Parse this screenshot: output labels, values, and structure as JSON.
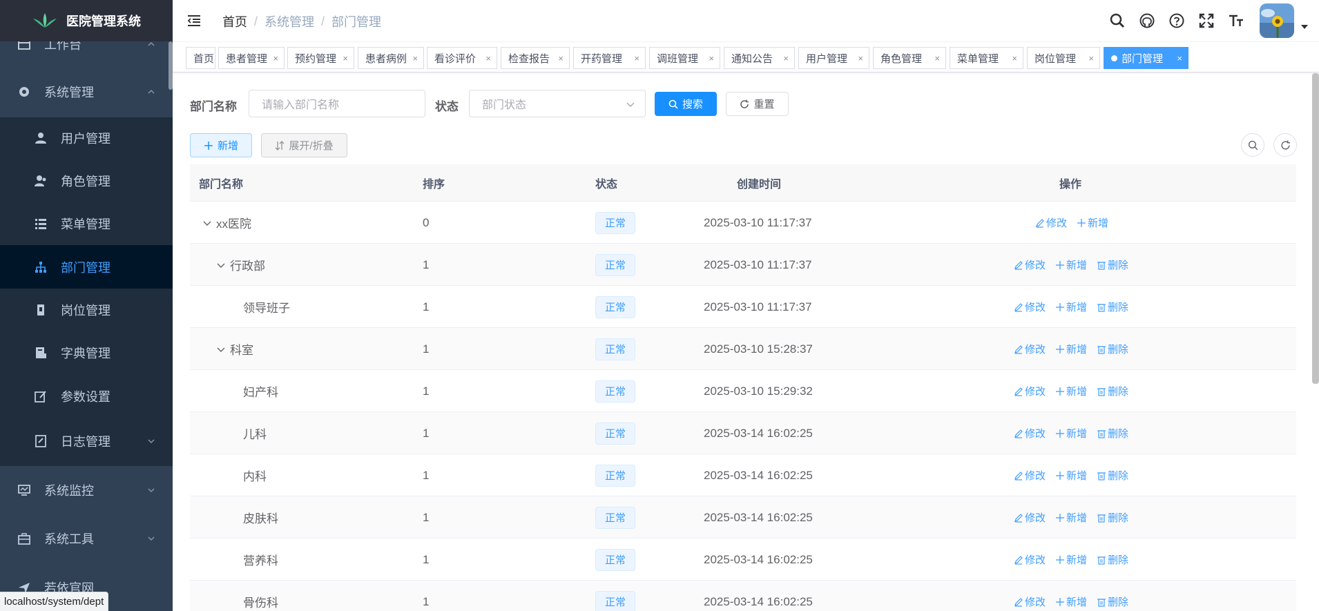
{
  "app": {
    "title": "医院管理系统"
  },
  "sidebar": {
    "items": [
      {
        "label": "工作台",
        "icon": "dashboard-icon"
      },
      {
        "label": "系统管理",
        "icon": "gear-icon"
      },
      {
        "label": "用户管理",
        "icon": "user-icon"
      },
      {
        "label": "角色管理",
        "icon": "peoples-icon"
      },
      {
        "label": "菜单管理",
        "icon": "tree-table-icon"
      },
      {
        "label": "部门管理",
        "icon": "tree-icon"
      },
      {
        "label": "岗位管理",
        "icon": "post-icon"
      },
      {
        "label": "字典管理",
        "icon": "dict-icon"
      },
      {
        "label": "参数设置",
        "icon": "edit-icon"
      },
      {
        "label": "日志管理",
        "icon": "log-icon"
      },
      {
        "label": "系统监控",
        "icon": "monitor-icon"
      },
      {
        "label": "系统工具",
        "icon": "tool-icon"
      },
      {
        "label": "若依官网",
        "icon": "guide-icon"
      }
    ]
  },
  "breadcrumb": [
    "首页",
    "系统管理",
    "部门管理"
  ],
  "breadcrumb_sep": "/",
  "tags": [
    {
      "label": "首页"
    },
    {
      "label": "患者管理"
    },
    {
      "label": "预约管理"
    },
    {
      "label": "患者病例"
    },
    {
      "label": "看诊评价"
    },
    {
      "label": "检查报告"
    },
    {
      "label": "开药管理"
    },
    {
      "label": "调班管理"
    },
    {
      "label": "通知公告"
    },
    {
      "label": "用户管理"
    },
    {
      "label": "角色管理"
    },
    {
      "label": "菜单管理"
    },
    {
      "label": "岗位管理"
    },
    {
      "label": "部门管理",
      "active": true
    }
  ],
  "search": {
    "dept_label": "部门名称",
    "dept_placeholder": "请输入部门名称",
    "status_label": "状态",
    "status_placeholder": "部门状态",
    "search_btn": "搜索",
    "reset_btn": "重置"
  },
  "toolbar": {
    "add_btn": "新增",
    "toggle_btn": "展开/折叠"
  },
  "table": {
    "headers": {
      "name": "部门名称",
      "order": "排序",
      "status": "状态",
      "created": "创建时间",
      "ops": "操作"
    },
    "op_labels": {
      "edit": "修改",
      "add": "新增",
      "delete": "删除"
    },
    "rows": [
      {
        "name": "xx医院",
        "order": "0",
        "status": "正常",
        "created": "2025-03-10 11:17:37"
      },
      {
        "name": "行政部",
        "order": "1",
        "status": "正常",
        "created": "2025-03-10 11:17:37"
      },
      {
        "name": "领导班子",
        "order": "1",
        "status": "正常",
        "created": "2025-03-10 11:17:37"
      },
      {
        "name": "科室",
        "order": "1",
        "status": "正常",
        "created": "2025-03-10 15:28:37"
      },
      {
        "name": "妇产科",
        "order": "1",
        "status": "正常",
        "created": "2025-03-10 15:29:32"
      },
      {
        "name": "儿科",
        "order": "1",
        "status": "正常",
        "created": "2025-03-14 16:02:25"
      },
      {
        "name": "内科",
        "order": "1",
        "status": "正常",
        "created": "2025-03-14 16:02:25"
      },
      {
        "name": "皮肤科",
        "order": "1",
        "status": "正常",
        "created": "2025-03-14 16:02:25"
      },
      {
        "name": "营养科",
        "order": "1",
        "status": "正常",
        "created": "2025-03-14 16:02:25"
      },
      {
        "name": "骨伤科",
        "order": "1",
        "status": "正常",
        "created": "2025-03-14 16:02:25"
      }
    ]
  },
  "status_url": "localhost/system/dept",
  "colors": {
    "sidebar_bg": "#304156",
    "accent": "#409eff",
    "primary": "#1890ff"
  }
}
